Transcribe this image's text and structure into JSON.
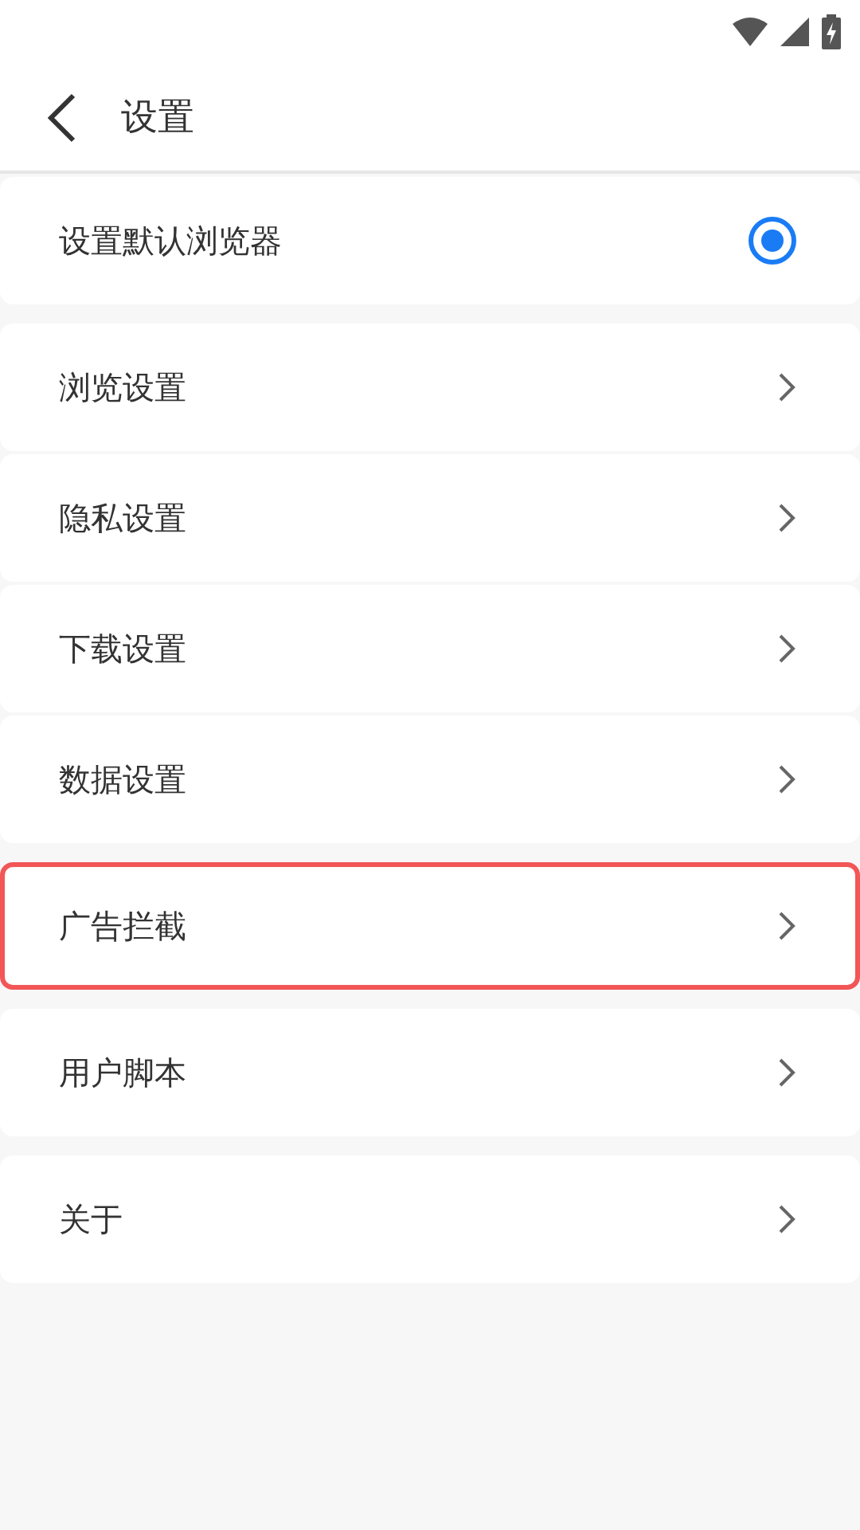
{
  "header": {
    "title": "设置"
  },
  "groups": [
    {
      "items": [
        {
          "kind": "radio",
          "label": "设置默认浏览器",
          "selected": true,
          "highlighted": false
        }
      ]
    },
    {
      "items": [
        {
          "kind": "link",
          "label": "浏览设置",
          "highlighted": false
        },
        {
          "kind": "link",
          "label": "隐私设置",
          "highlighted": false
        },
        {
          "kind": "link",
          "label": "下载设置",
          "highlighted": false
        },
        {
          "kind": "link",
          "label": "数据设置",
          "highlighted": false
        }
      ]
    },
    {
      "items": [
        {
          "kind": "link",
          "label": "广告拦截",
          "highlighted": true
        }
      ]
    },
    {
      "items": [
        {
          "kind": "link",
          "label": "用户脚本",
          "highlighted": false
        }
      ]
    },
    {
      "items": [
        {
          "kind": "link",
          "label": "关于",
          "highlighted": false
        }
      ]
    }
  ]
}
